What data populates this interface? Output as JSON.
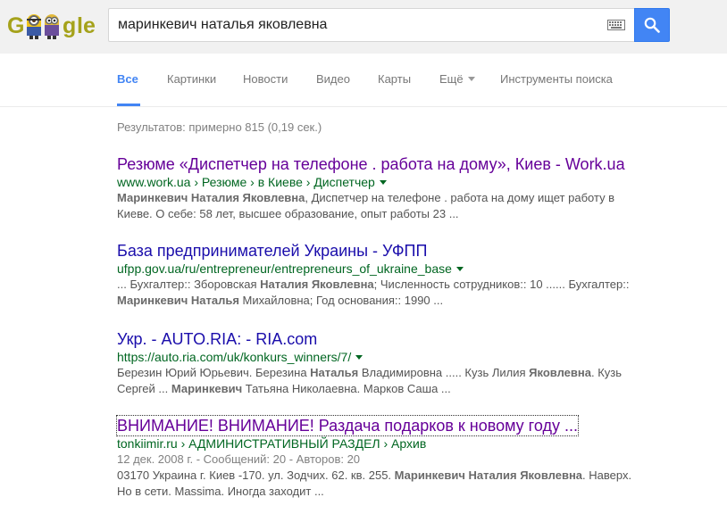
{
  "search": {
    "query": "маринкевич наталья яковлевна",
    "logo_letters": [
      "G",
      "o",
      "o",
      "g",
      "l",
      "e"
    ]
  },
  "tabs": [
    {
      "label": "Все",
      "active": true
    },
    {
      "label": "Картинки"
    },
    {
      "label": "Новости"
    },
    {
      "label": "Видео"
    },
    {
      "label": "Карты"
    },
    {
      "label": "Ещё"
    },
    {
      "label": "Инструменты поиска"
    }
  ],
  "stats": "Результатов: примерно 815 (0,19 сек.)",
  "results": [
    {
      "title": "Резюме «Диспетчер на телефоне . работа на дому», Киев - Work.ua",
      "url": "www.work.ua › Резюме › в Киеве › Диспетчер",
      "snippet_lines": [
        [
          {
            "t": "Маринкевич Наталия Яковлевна",
            "b": true
          },
          {
            "t": ", Диспетчер на телефоне . работа на дому ищет работу в"
          }
        ],
        [
          {
            "t": "Киеве. О себе: 58 лет, высшее образование, опыт работы 23 ..."
          }
        ]
      ]
    },
    {
      "title": "База предпринимателей Украины - УФПП",
      "url": "ufpp.gov.ua/ru/entrepreneur/entrepreneurs_of_ukraine_base",
      "snippet_lines": [
        [
          {
            "t": "... Бухгалтер:: Зборовская "
          },
          {
            "t": "Наталия Яковлевна",
            "b": true
          },
          {
            "t": "; Численность сотрудников:: 10 ...... Бухгалтер::"
          }
        ],
        [
          {
            "t": "Маринкевич Наталья",
            "b": true
          },
          {
            "t": " Михайловна; Год основания:: 1990 ..."
          }
        ]
      ]
    },
    {
      "title": "Укр. - AUTO.RIA: - RIA.com",
      "url": "https://auto.ria.com/uk/konkurs_winners/7/",
      "snippet_lines": [
        [
          {
            "t": "Березин Юрий Юрьевич. Березина "
          },
          {
            "t": "Наталья",
            "b": true
          },
          {
            "t": " Владимировна ..... Кузь Лилия "
          },
          {
            "t": "Яковлевна",
            "b": true
          },
          {
            "t": ". Кузь"
          }
        ],
        [
          {
            "t": "Сергей ... "
          },
          {
            "t": "Маринкевич",
            "b": true
          },
          {
            "t": " Татьяна Николаевна. Марков Саша ..."
          }
        ]
      ]
    },
    {
      "title": "ВНИМАНИЕ! ВНИМАНИЕ! Раздача подарков к новому году ...",
      "url": "tonkiimir.ru › АДМИНИСТРАТИВНЫЙ РАЗДЕЛ › Архив",
      "meta": "12 дек. 2008 г. - Сообщений: 20 - Авторов: 20",
      "snippet_lines": [
        [
          {
            "t": "03170 Украина г. Киев -170. ул. Зодчих. 62. кв. 255. "
          },
          {
            "t": "Маринкевич Наталия Яковлевна",
            "b": true
          },
          {
            "t": ". Наверх."
          }
        ],
        [
          {
            "t": "Но в сети. Massima. Иногда заходит ..."
          }
        ]
      ]
    }
  ]
}
